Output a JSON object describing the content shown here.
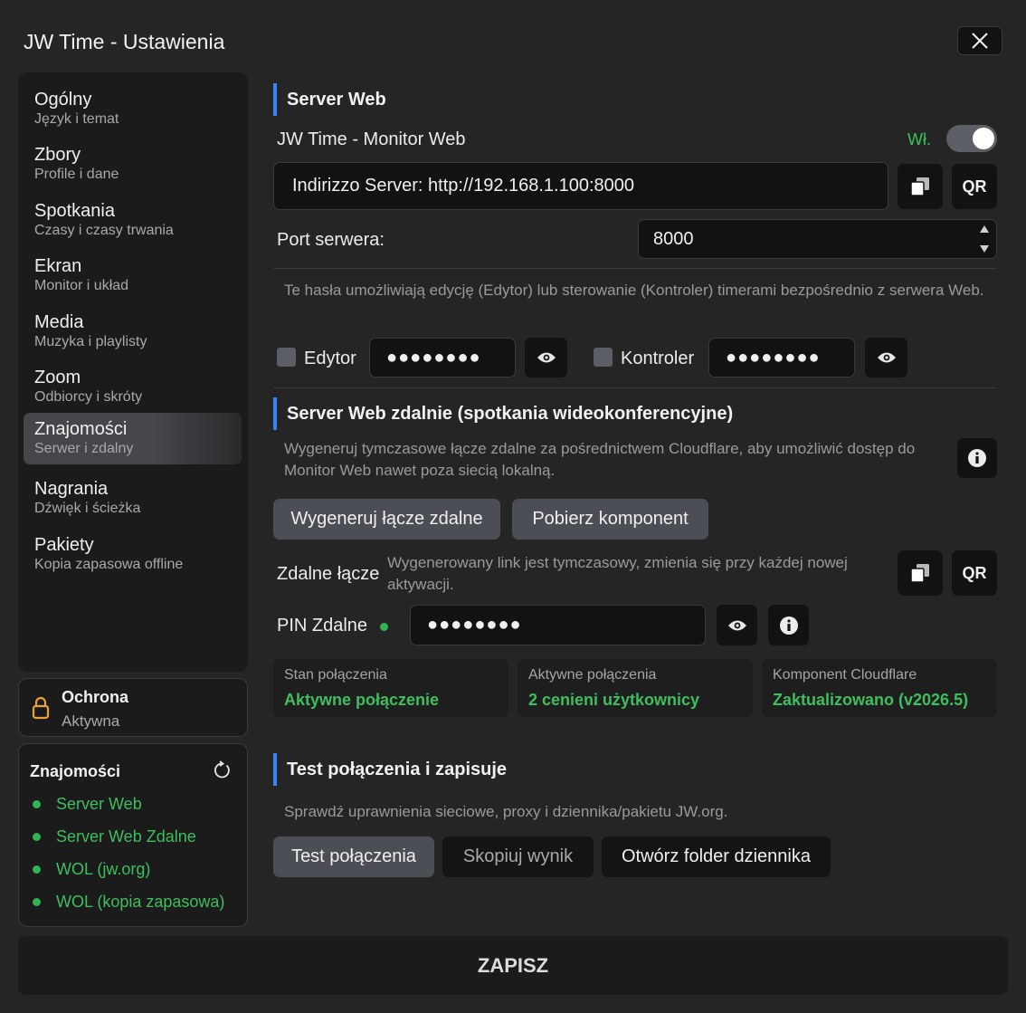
{
  "window": {
    "title": "JW Time - Ustawienia"
  },
  "nav": [
    {
      "label": "Ogólny",
      "sub": "Język i temat"
    },
    {
      "label": "Zbory",
      "sub": "Profile i dane"
    },
    {
      "label": "Spotkania",
      "sub": "Czasy i czasy trwania"
    },
    {
      "label": "Ekran",
      "sub": "Monitor i układ"
    },
    {
      "label": "Media",
      "sub": "Muzyka i playlisty"
    },
    {
      "label": "Zoom",
      "sub": "Odbiorcy i skróty"
    },
    {
      "label": "Znajomości",
      "sub": "Serwer i zdalny"
    },
    {
      "label": "Nagrania",
      "sub": "Dźwięk i ścieżka"
    },
    {
      "label": "Pakiety",
      "sub": "Kopia zapasowa offline"
    }
  ],
  "protection": {
    "title": "Ochrona",
    "status": "Aktywna"
  },
  "status_panel": {
    "title": "Znajomości",
    "items": [
      "Server Web",
      "Server Web Zdalne",
      "WOL (jw.org)",
      "WOL (kopia zapasowa)"
    ]
  },
  "web_server": {
    "heading": "Server Web",
    "monitor_label": "JW Time - Monitor Web",
    "toggle_label": "Wł.",
    "address": "Indirizzo Server: http://192.168.1.100:8000",
    "qr_label": "QR",
    "port_label": "Port serwera:",
    "port_value": "8000",
    "password_note": "Te hasła umożliwiają edycję (Edytor) lub sterowanie (Kontroler) timerami bezpośrednio z serwera Web.",
    "editor_label": "Edytor",
    "editor_password": "●●●●●●●●",
    "controller_label": "Kontroler",
    "controller_password": "●●●●●●●●"
  },
  "remote": {
    "heading": "Server Web zdalnie (spotkania wideokonferencyjne)",
    "description": "Wygeneruj tymczasowe łącze zdalne za pośrednictwem Cloudflare, aby umożliwić dostęp do Monitor Web nawet poza siecią lokalną.",
    "generate_button": "Wygeneruj łącze zdalne",
    "download_button": "Pobierz komponent",
    "link_label": "Zdalne łącze",
    "link_note": "Wygenerowany link jest tymczasowy, zmienia się przy każdej nowej aktywacji.",
    "qr_label": "QR",
    "pin_label": "PIN Zdalne",
    "pin_value": "●●●●●●●●",
    "stats": [
      {
        "label": "Stan połączenia",
        "value": "Aktywne połączenie"
      },
      {
        "label": "Aktywne połączenia",
        "value": "2 cenieni użytkownicy"
      },
      {
        "label": "Komponent Cloudflare",
        "value": "Zaktualizowano (v2026.5)"
      }
    ]
  },
  "test": {
    "heading": "Test połączenia i zapisuje",
    "description": "Sprawdź uprawnienia sieciowe, proxy i dziennika/pakietu JW.org.",
    "test_button": "Test połączenia",
    "copy_button": "Skopiuj wynik",
    "open_button": "Otwórz folder dziennika"
  },
  "save_label": "ZAPISZ",
  "colors": {
    "accent": "#3b82f6",
    "status_green": "#3dbf5e",
    "background": "#252525"
  }
}
